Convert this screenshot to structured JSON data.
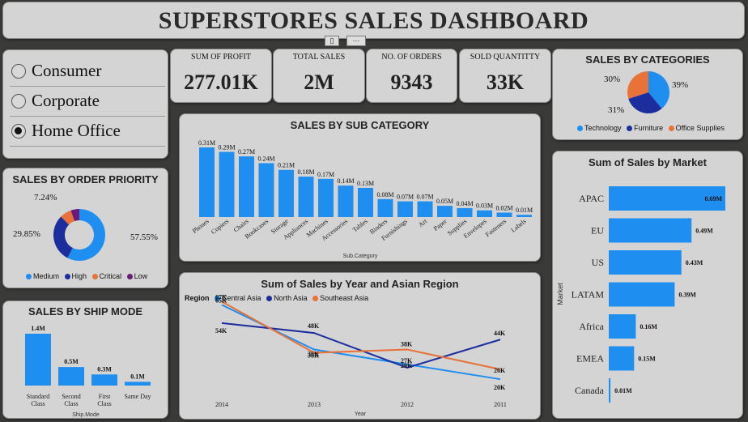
{
  "title": "SUPERSTORES SALES DASHBOARD",
  "header_buttons": {
    "focus": "▯",
    "more": "···"
  },
  "slicer": {
    "items": [
      {
        "label": "Consumer",
        "selected": false
      },
      {
        "label": "Corporate",
        "selected": false
      },
      {
        "label": "Home Office",
        "selected": true
      }
    ]
  },
  "kpis": [
    {
      "label": "SUM OF PROFIT",
      "value": "277.01K"
    },
    {
      "label": "TOTAL SALES",
      "value": "2M"
    },
    {
      "label": "NO. OF ORDERS",
      "value": "9343"
    },
    {
      "label": "SOLD QUANTITTY",
      "value": "33K"
    }
  ],
  "colors": {
    "blue": "#1f8ef1",
    "navy": "#1c2d9e",
    "orange": "#e87238",
    "purple": "#6b1a7a"
  },
  "chart_data": [
    {
      "id": "categories",
      "type": "pie",
      "title": "SALES BY CATEGORIES",
      "slices": [
        {
          "name": "Technology",
          "value": 39,
          "label": "39%",
          "color": "#1f8ef1"
        },
        {
          "name": "Furniture",
          "value": 31,
          "label": "31%",
          "color": "#1c2d9e"
        },
        {
          "name": "Office Supplies",
          "value": 30,
          "label": "30%",
          "color": "#e87238"
        }
      ]
    },
    {
      "id": "priority",
      "type": "pie",
      "title": "SALES BY ORDER PRIORITY",
      "donut": true,
      "slices": [
        {
          "name": "Medium",
          "value": 57.55,
          "label": "57.55%",
          "color": "#1f8ef1"
        },
        {
          "name": "High",
          "value": 29.85,
          "label": "29.85%",
          "color": "#1c2d9e"
        },
        {
          "name": "Critical",
          "value": 7.24,
          "label": "7.24%",
          "color": "#e87238"
        },
        {
          "name": "Low",
          "value": 5.36,
          "label": "",
          "color": "#6b1a7a"
        }
      ]
    },
    {
      "id": "subcategory",
      "type": "bar",
      "title": "SALES BY SUB CATEGORY",
      "xlabel": "Sub.Category",
      "categories": [
        "Phones",
        "Copiers",
        "Chairs",
        "Bookcases",
        "Storage",
        "Appliances",
        "Machines",
        "Accessories",
        "Tables",
        "Binders",
        "Furnishings",
        "Art",
        "Paper",
        "Supplies",
        "Envelopes",
        "Fasteners",
        "Labels"
      ],
      "values": [
        0.31,
        0.29,
        0.27,
        0.24,
        0.21,
        0.18,
        0.17,
        0.14,
        0.13,
        0.08,
        0.07,
        0.07,
        0.05,
        0.04,
        0.03,
        0.02,
        0.01
      ],
      "labels": [
        "0.31M",
        "0.29M",
        "0.27M",
        "0.24M",
        "0.21M",
        "0.18M",
        "0.17M",
        "0.14M",
        "0.13M",
        "0.08M",
        "0.07M",
        "0.07M",
        "0.05M",
        "0.04M",
        "0.03M",
        "0.02M",
        "0.01M"
      ]
    },
    {
      "id": "shipmode",
      "type": "bar",
      "title": "SALES BY SHIP MODE",
      "xlabel": "Ship.Mode",
      "categories": [
        "Standard Class",
        "Second Class",
        "First Class",
        "Same Day"
      ],
      "values": [
        1.4,
        0.5,
        0.3,
        0.1
      ],
      "labels": [
        "1.4M",
        "0.5M",
        "0.3M",
        "0.1M"
      ]
    },
    {
      "id": "region",
      "type": "line",
      "title": "Sum of Sales by Year and Asian Region",
      "legend_title": "Region",
      "xlabel": "Year",
      "x": [
        "2014",
        "2013",
        "2012",
        "2011"
      ],
      "series": [
        {
          "name": "Central Asia",
          "color": "#1f8ef1",
          "values": [
            65,
            38,
            29,
            20
          ],
          "labels": [
            "65K",
            "38K",
            "29K",
            "20K"
          ]
        },
        {
          "name": "North Asia",
          "color": "#1c2d9e",
          "values": [
            54,
            48,
            27,
            44
          ],
          "labels": [
            "54K",
            "48K",
            "27K",
            "44K"
          ]
        },
        {
          "name": "Southeast Asia",
          "color": "#e87238",
          "values": [
            67,
            36,
            38,
            26
          ],
          "labels": [
            "67K",
            "36K",
            "38K",
            "26K"
          ]
        }
      ]
    },
    {
      "id": "market",
      "type": "bar",
      "orientation": "horizontal",
      "title": "Sum of Sales by Market",
      "ylabel": "Market",
      "categories": [
        "APAC",
        "EU",
        "US",
        "LATAM",
        "Africa",
        "EMEA",
        "Canada"
      ],
      "values": [
        0.69,
        0.49,
        0.43,
        0.39,
        0.16,
        0.15,
        0.01
      ],
      "labels": [
        "0.69M",
        "0.49M",
        "0.43M",
        "0.39M",
        "0.16M",
        "0.15M",
        "0.01M"
      ]
    }
  ]
}
